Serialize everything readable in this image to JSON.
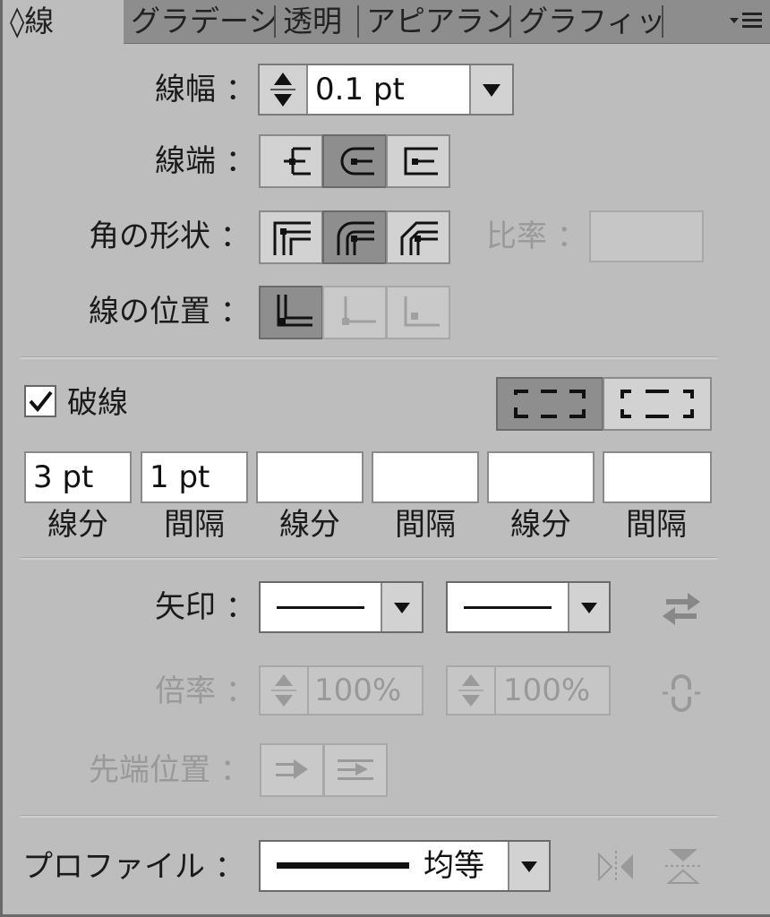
{
  "tabs": [
    {
      "label": "◊線",
      "active": true
    },
    {
      "label": "グラデーシ"
    },
    {
      "label": "透明"
    },
    {
      "label": "アピアランフ"
    },
    {
      "label": "グラフィック"
    }
  ],
  "stroke": {
    "weight_label": "線幅 ：",
    "weight_value": "0.1 pt",
    "cap_label": "線端 ：",
    "corner_label": "角の形状 ：",
    "limit_label": "比率 ：",
    "limit_value": "",
    "align_label": "線の位置 ："
  },
  "dashed": {
    "checkbox_label": "破線",
    "checked": true,
    "fields": [
      {
        "value": "3 pt",
        "caption": "線分"
      },
      {
        "value": "1 pt",
        "caption": "間隔"
      },
      {
        "value": "",
        "caption": "線分"
      },
      {
        "value": "",
        "caption": "間隔"
      },
      {
        "value": "",
        "caption": "線分"
      },
      {
        "value": "",
        "caption": "間隔"
      }
    ]
  },
  "arrows": {
    "label": "矢印 ：",
    "scale_label": "倍率 ：",
    "scale_start": "100%",
    "scale_end": "100%",
    "align_label": "先端位置 ："
  },
  "profile": {
    "label": "プロファイル ：",
    "value": "均等"
  }
}
